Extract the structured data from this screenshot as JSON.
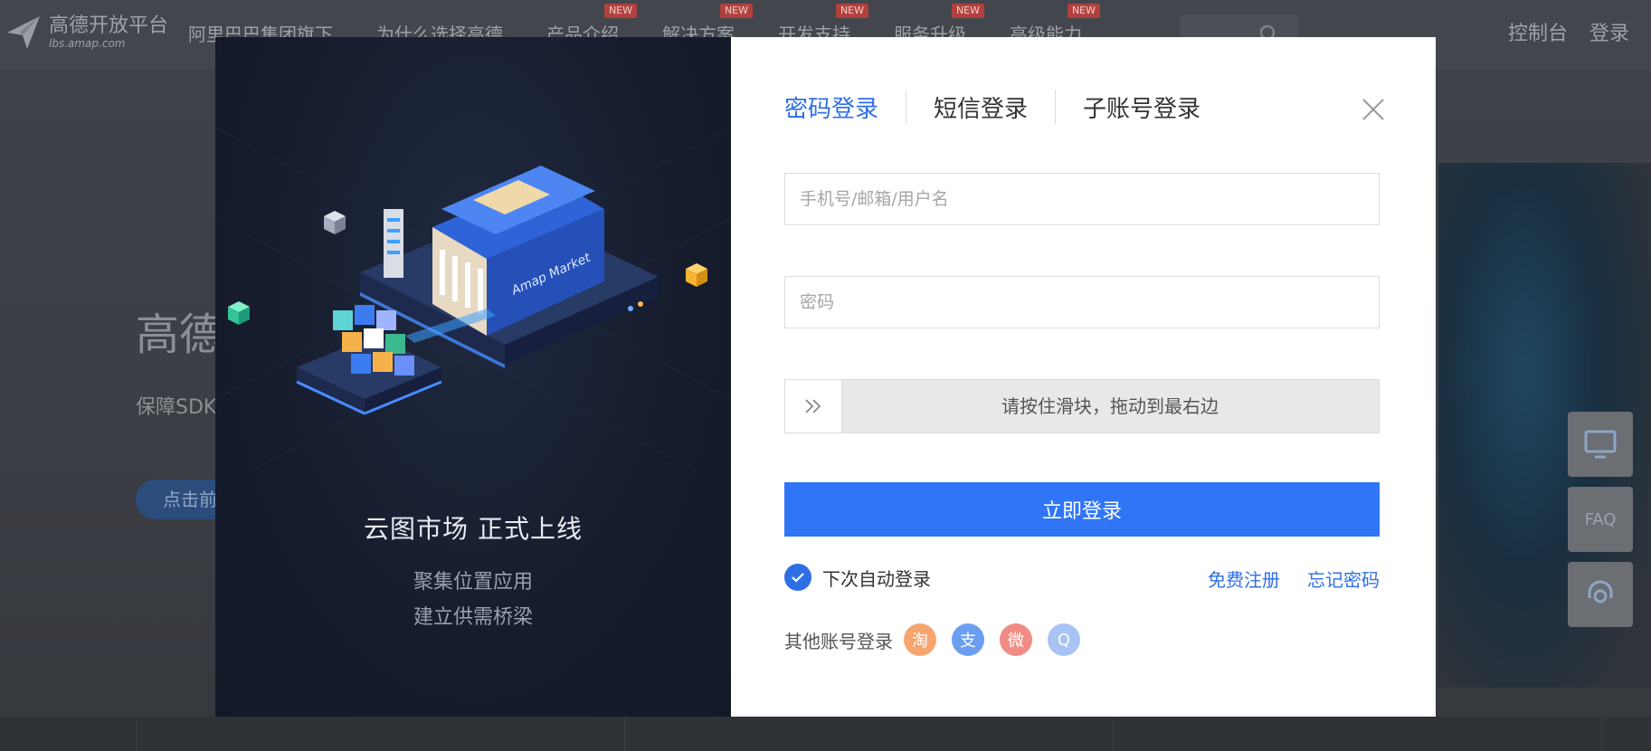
{
  "site": {
    "logo_title": "高德开放平台",
    "logo_sub": "lbs.amap.com",
    "nav": [
      {
        "label": "阿里巴巴集团旗下",
        "badge": ""
      },
      {
        "label": "为什么选择高德",
        "badge": ""
      },
      {
        "label": "产品介绍",
        "badge": "NEW"
      },
      {
        "label": "解决方案",
        "badge": "NEW"
      },
      {
        "label": "开发支持",
        "badge": "NEW"
      },
      {
        "label": "服务升级",
        "badge": "NEW"
      },
      {
        "label": "高级能力",
        "badge": "NEW"
      }
    ],
    "console_label": "控制台",
    "login_label": "登录",
    "hero_title": "高德",
    "hero_sub": "保障SDK",
    "hero_button": "点击前",
    "side_faq": "FAQ"
  },
  "illustration": {
    "market_label": "Amap Market",
    "title": "云图市场  正式上线",
    "line1": "聚集位置应用",
    "line2": "建立供需桥梁"
  },
  "login": {
    "tabs": [
      "密码登录",
      "短信登录",
      "子账号登录"
    ],
    "active_tab": 0,
    "account_placeholder": "手机号/邮箱/用户名",
    "password_placeholder": "密码",
    "slider_text": "请按住滑块，拖动到最右边",
    "submit_label": "立即登录",
    "remember_label": "下次自动登录",
    "remember_checked": true,
    "register_label": "免费注册",
    "forgot_label": "忘记密码",
    "other_label": "其他账号登录",
    "social": [
      {
        "name": "taobao",
        "glyph": "淘",
        "color": "#f7a56f"
      },
      {
        "name": "alipay",
        "glyph": "支",
        "color": "#6b9ef0"
      },
      {
        "name": "weibo",
        "glyph": "微",
        "color": "#f08c84"
      },
      {
        "name": "qq",
        "glyph": "Q",
        "color": "#a9c3f4"
      }
    ]
  },
  "colors": {
    "accent": "#2f6fe6",
    "button": "#2f75f6"
  }
}
